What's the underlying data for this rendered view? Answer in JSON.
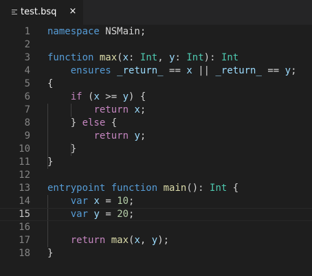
{
  "tab": {
    "title": "test.bsq",
    "close_symbol": "×",
    "icon": "file-lines-icon"
  },
  "colors": {
    "background": "#1e1e1e",
    "tabbar": "#252526",
    "line_number": "#858585",
    "keyword": "#569cd6",
    "control": "#c586c0",
    "function": "#dcdcaa",
    "type": "#4ec9b0",
    "variable": "#9cdcfe",
    "number": "#b5cea8",
    "text": "#d4d4d4"
  },
  "editor": {
    "current_line": 15,
    "lines": [
      {
        "n": "1",
        "tokens": [
          [
            "kw",
            "namespace"
          ],
          [
            "t",
            " NSMain;"
          ]
        ]
      },
      {
        "n": "2",
        "tokens": []
      },
      {
        "n": "3",
        "tokens": [
          [
            "kw",
            "function"
          ],
          [
            "t",
            " "
          ],
          [
            "fn",
            "max"
          ],
          [
            "t",
            "("
          ],
          [
            "var",
            "x"
          ],
          [
            "t",
            ": "
          ],
          [
            "ty",
            "Int"
          ],
          [
            "t",
            ", "
          ],
          [
            "var",
            "y"
          ],
          [
            "t",
            ": "
          ],
          [
            "ty",
            "Int"
          ],
          [
            "t",
            "): "
          ],
          [
            "ty",
            "Int"
          ]
        ]
      },
      {
        "n": "4",
        "tokens": [
          [
            "t",
            "    "
          ],
          [
            "kw",
            "ensures"
          ],
          [
            "t",
            " "
          ],
          [
            "var",
            "_return_"
          ],
          [
            "t",
            " == "
          ],
          [
            "var",
            "x"
          ],
          [
            "t",
            " || "
          ],
          [
            "var",
            "_return_"
          ],
          [
            "t",
            " == "
          ],
          [
            "var",
            "y"
          ],
          [
            "t",
            ";"
          ]
        ]
      },
      {
        "n": "5",
        "tokens": [
          [
            "t",
            "{"
          ]
        ]
      },
      {
        "n": "6",
        "tokens": [
          [
            "t",
            "    "
          ],
          [
            "ctl",
            "if"
          ],
          [
            "t",
            " ("
          ],
          [
            "var",
            "x"
          ],
          [
            "t",
            " >= "
          ],
          [
            "var",
            "y"
          ],
          [
            "t",
            ") {"
          ]
        ]
      },
      {
        "n": "7",
        "tokens": [
          [
            "t",
            "        "
          ],
          [
            "ctl",
            "return"
          ],
          [
            "t",
            " "
          ],
          [
            "var",
            "x"
          ],
          [
            "t",
            ";"
          ]
        ]
      },
      {
        "n": "8",
        "tokens": [
          [
            "t",
            "    } "
          ],
          [
            "ctl",
            "else"
          ],
          [
            "t",
            " {"
          ]
        ]
      },
      {
        "n": "9",
        "tokens": [
          [
            "t",
            "        "
          ],
          [
            "ctl",
            "return"
          ],
          [
            "t",
            " "
          ],
          [
            "var",
            "y"
          ],
          [
            "t",
            ";"
          ]
        ]
      },
      {
        "n": "10",
        "tokens": [
          [
            "t",
            "    }"
          ]
        ]
      },
      {
        "n": "11",
        "tokens": [
          [
            "t",
            "}"
          ]
        ]
      },
      {
        "n": "12",
        "tokens": []
      },
      {
        "n": "13",
        "tokens": [
          [
            "kw",
            "entrypoint"
          ],
          [
            "t",
            " "
          ],
          [
            "kw",
            "function"
          ],
          [
            "t",
            " "
          ],
          [
            "fn",
            "main"
          ],
          [
            "t",
            "(): "
          ],
          [
            "ty",
            "Int"
          ],
          [
            "t",
            " {"
          ]
        ]
      },
      {
        "n": "14",
        "tokens": [
          [
            "t",
            "    "
          ],
          [
            "kw",
            "var"
          ],
          [
            "t",
            " "
          ],
          [
            "var",
            "x"
          ],
          [
            "t",
            " = "
          ],
          [
            "num",
            "10"
          ],
          [
            "t",
            ";"
          ]
        ]
      },
      {
        "n": "15",
        "tokens": [
          [
            "t",
            "    "
          ],
          [
            "kw",
            "var"
          ],
          [
            "t",
            " "
          ],
          [
            "var",
            "y"
          ],
          [
            "t",
            " = "
          ],
          [
            "num",
            "20"
          ],
          [
            "t",
            ";"
          ]
        ]
      },
      {
        "n": "16",
        "tokens": []
      },
      {
        "n": "17",
        "tokens": [
          [
            "t",
            "    "
          ],
          [
            "ctl",
            "return"
          ],
          [
            "t",
            " "
          ],
          [
            "fn",
            "max"
          ],
          [
            "t",
            "("
          ],
          [
            "var",
            "x"
          ],
          [
            "t",
            ", "
          ],
          [
            "var",
            "y"
          ],
          [
            "t",
            ");"
          ]
        ]
      },
      {
        "n": "18",
        "tokens": [
          [
            "t",
            "}"
          ]
        ]
      }
    ]
  }
}
